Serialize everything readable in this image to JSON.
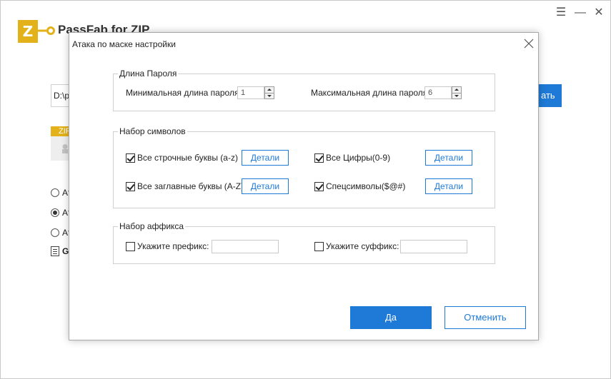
{
  "app": {
    "title": "PassFab for ZIP",
    "logo_letter": "Z",
    "path_value": "D:\\p",
    "start_label": "ать",
    "zip_badge": "ZIP",
    "radio_options": [
      {
        "label": "Ат",
        "checked": false
      },
      {
        "label": "Ат",
        "checked": true
      },
      {
        "label": "Ат",
        "checked": false
      }
    ],
    "guide_label": "G",
    "window_controls": {
      "menu": "☰",
      "minimize": "—",
      "close": "✕"
    }
  },
  "dialog": {
    "title": "Атака по маске настройки",
    "password_length": {
      "legend": "Длина Пароля",
      "min_label": "Минимальная длина пароля",
      "min_value": "1",
      "max_label": "Максимальная длина пароля",
      "max_value": "6"
    },
    "charset": {
      "legend": "Набор символов",
      "options": [
        {
          "label": "Все строчные буквы (a-z)",
          "checked": true,
          "details": "Детали"
        },
        {
          "label": "Все Цифры(0-9)",
          "checked": true,
          "details": "Детали"
        },
        {
          "label": "Все заглавные буквы (A-Z)",
          "checked": true,
          "details": "Детали"
        },
        {
          "label": "Спецсимволы($@#)",
          "checked": true,
          "details": "Детали"
        }
      ]
    },
    "affix": {
      "legend": "Набор аффикса",
      "prefix_label": "Укажите префикс:",
      "prefix_checked": false,
      "prefix_value": "",
      "suffix_label": "Укажите суффикс:",
      "suffix_checked": false,
      "suffix_value": ""
    },
    "ok_label": "Да",
    "cancel_label": "Отменить"
  },
  "colors": {
    "accent": "#1e7ad6",
    "brand": "#e3b21b"
  }
}
